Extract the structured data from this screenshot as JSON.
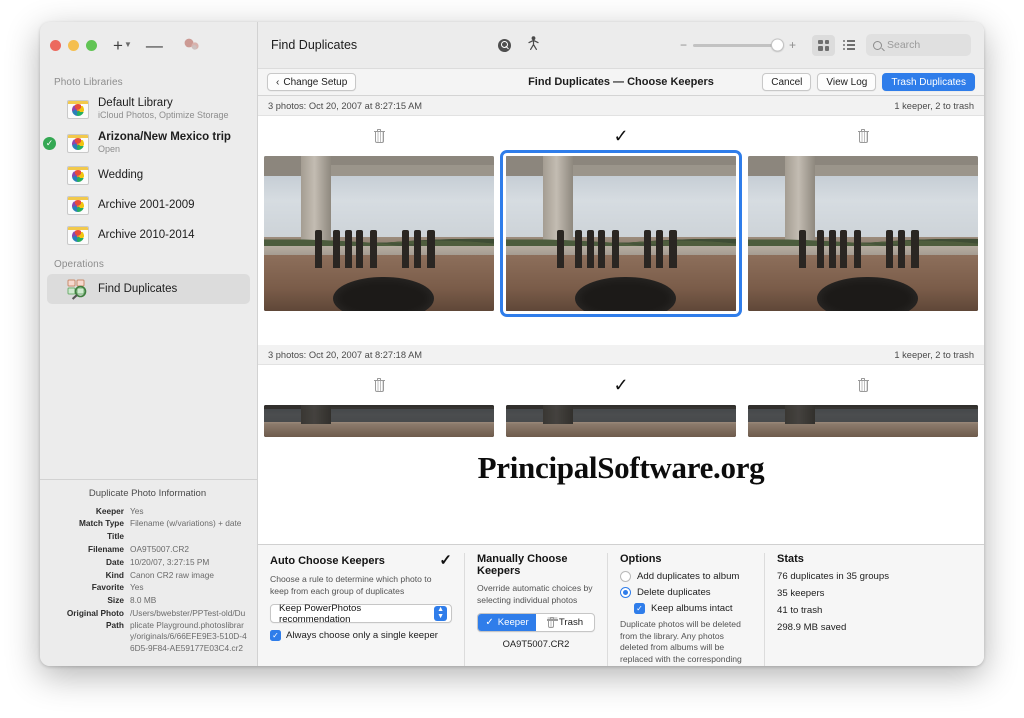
{
  "window": {
    "traffic_lights": [
      "close",
      "minimize",
      "zoom"
    ],
    "sidebar_toolbar": {
      "add_label": "+",
      "add_caret": "⌄",
      "remove_label": "—",
      "pill_icon": "people-pill-icon"
    }
  },
  "sidebar": {
    "sections": [
      {
        "title": "Photo Libraries"
      },
      {
        "title": "Operations"
      }
    ],
    "libraries": [
      {
        "name": "Default Library",
        "subtitle": "iCloud Photos, Optimize Storage",
        "selected": false,
        "active": false,
        "bold": false
      },
      {
        "name": "Arizona/New Mexico trip",
        "subtitle": "Open",
        "selected": false,
        "active": true,
        "bold": true
      },
      {
        "name": "Wedding",
        "subtitle": "",
        "selected": false,
        "active": false,
        "bold": false
      },
      {
        "name": "Archive 2001-2009",
        "subtitle": "",
        "selected": false,
        "active": false,
        "bold": false
      },
      {
        "name": "Archive 2010-2014",
        "subtitle": "",
        "selected": false,
        "active": false,
        "bold": false
      }
    ],
    "operations": [
      {
        "name": "Find Duplicates",
        "selected": true
      }
    ],
    "info": {
      "heading": "Duplicate Photo Information",
      "rows": [
        {
          "key": "Keeper",
          "value": "Yes"
        },
        {
          "key": "Match Type",
          "value": "Filename (w/variations) + date"
        },
        {
          "key": "Title",
          "value": ""
        },
        {
          "key": "Filename",
          "value": "OA9T5007.CR2"
        },
        {
          "key": "Date",
          "value": "10/20/07, 3:27:15 PM"
        },
        {
          "key": "Kind",
          "value": "Canon CR2 raw image"
        },
        {
          "key": "Favorite",
          "value": "Yes"
        },
        {
          "key": "Size",
          "value": "8.0 MB"
        },
        {
          "key": "Original Photo Path",
          "value": "/Users/bwebster/PPTest-old/Duplicate Playground.photoslibrary/originals/6/66EFE9E3-510D-46D5-9F84-AE59177E03C4.cr2"
        }
      ]
    }
  },
  "toolbar": {
    "title": "Find Duplicates",
    "find_icon": "find-duplicates-icon",
    "people_icon": "people-icon",
    "zoom_minus": "−",
    "zoom_plus": "+",
    "zoom_value": "98",
    "grid_view_icon": "grid-view-icon",
    "list_view_icon": "list-view-icon",
    "search_icon": "search-icon",
    "search_placeholder": "Search",
    "search_value": ""
  },
  "subbar": {
    "back_label": "Change Setup",
    "back_chevron": "‹",
    "center_title": "Find Duplicates — Choose Keepers",
    "cancel_label": "Cancel",
    "view_log_label": "View Log",
    "trash_label": "Trash Duplicates"
  },
  "watermark": "PrincipalSoftware.org",
  "groups": [
    {
      "header_left": "3 photos: Oct 20, 2007 at 8:27:15 AM",
      "header_right": "1 keeper, 2 to trash",
      "photos": [
        {
          "mark": "trash",
          "selected": false,
          "dark": false
        },
        {
          "mark": "keeper",
          "selected": true,
          "dark": false
        },
        {
          "mark": "trash",
          "selected": false,
          "dark": false
        }
      ]
    },
    {
      "header_left": "3 photos: Oct 20, 2007 at 8:27:18 AM",
      "header_right": "1 keeper, 2 to trash",
      "photos": [
        {
          "mark": "trash",
          "selected": false,
          "dark": true
        },
        {
          "mark": "keeper",
          "selected": false,
          "dark": true
        },
        {
          "mark": "trash",
          "selected": false,
          "dark": true
        }
      ]
    }
  ],
  "bottom": {
    "auto": {
      "title": "Auto Choose Keepers",
      "check": "✓",
      "description": "Choose a rule to determine which photo to keep from each group of duplicates",
      "rule_value": "Keep PowerPhotos recommendation",
      "single_keeper_label": "Always choose only a single keeper",
      "single_keeper_checked": true
    },
    "manual": {
      "title": "Manually Choose Keepers",
      "description": "Override automatic choices by selecting individual photos",
      "keeper_label": "Keeper",
      "trash_label": "Trash",
      "selected_segment": "Keeper",
      "caption": "OA9T5007.CR2"
    },
    "options": {
      "title": "Options",
      "items": [
        {
          "label": "Add duplicates to album",
          "type": "radio",
          "checked": false,
          "indent": false
        },
        {
          "label": "Delete duplicates",
          "type": "radio",
          "checked": true,
          "indent": false
        },
        {
          "label": "Keep albums intact",
          "type": "checkbox",
          "checked": true,
          "indent": true
        }
      ],
      "note": "Duplicate photos will be deleted from the library. Any photos deleted from albums will be replaced with the corresponding keeper photo."
    },
    "stats": {
      "title": "Stats",
      "lines": [
        "76 duplicates in 35 groups",
        "35 keepers",
        "41 to trash",
        "298.9 MB saved"
      ]
    }
  },
  "colors": {
    "accent": "#2f7dea",
    "active_green": "#34a853",
    "sidebar_bg": "#ececec",
    "panel_bg": "#f6f6f6"
  }
}
